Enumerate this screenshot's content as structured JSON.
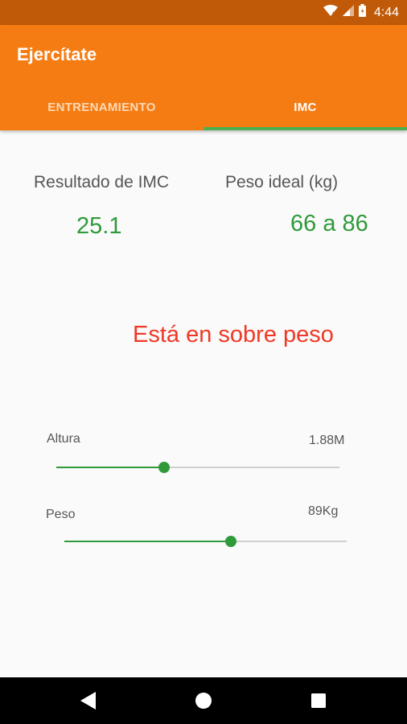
{
  "status_bar": {
    "time": "4:44"
  },
  "app_bar": {
    "title": "Ejercítate",
    "tabs": [
      {
        "label": "ENTRENAMIENTO",
        "selected": false
      },
      {
        "label": "IMC",
        "selected": true
      }
    ]
  },
  "results": {
    "imc_label": "Resultado de IMC",
    "imc_value": "25.1",
    "peso_ideal_label": "Peso ideal (kg)",
    "peso_ideal_value": "66 a 86"
  },
  "status_message": "Está en sobre peso",
  "sliders": {
    "altura": {
      "label": "Altura",
      "value_text": "1.88M",
      "fraction": 0.38
    },
    "peso": {
      "label": "Peso",
      "value_text": "89Kg",
      "fraction": 0.59
    }
  },
  "colors": {
    "accent_green": "#2e9a3a",
    "app_bar_orange": "#f57c13",
    "status_bar_orange": "#c05a08",
    "warning_red": "#f03826"
  },
  "icons": {
    "wifi": "wifi-icon",
    "signal": "signal-icon",
    "battery": "battery-icon",
    "back": "back-icon",
    "home": "home-icon",
    "recents": "recents-icon"
  }
}
